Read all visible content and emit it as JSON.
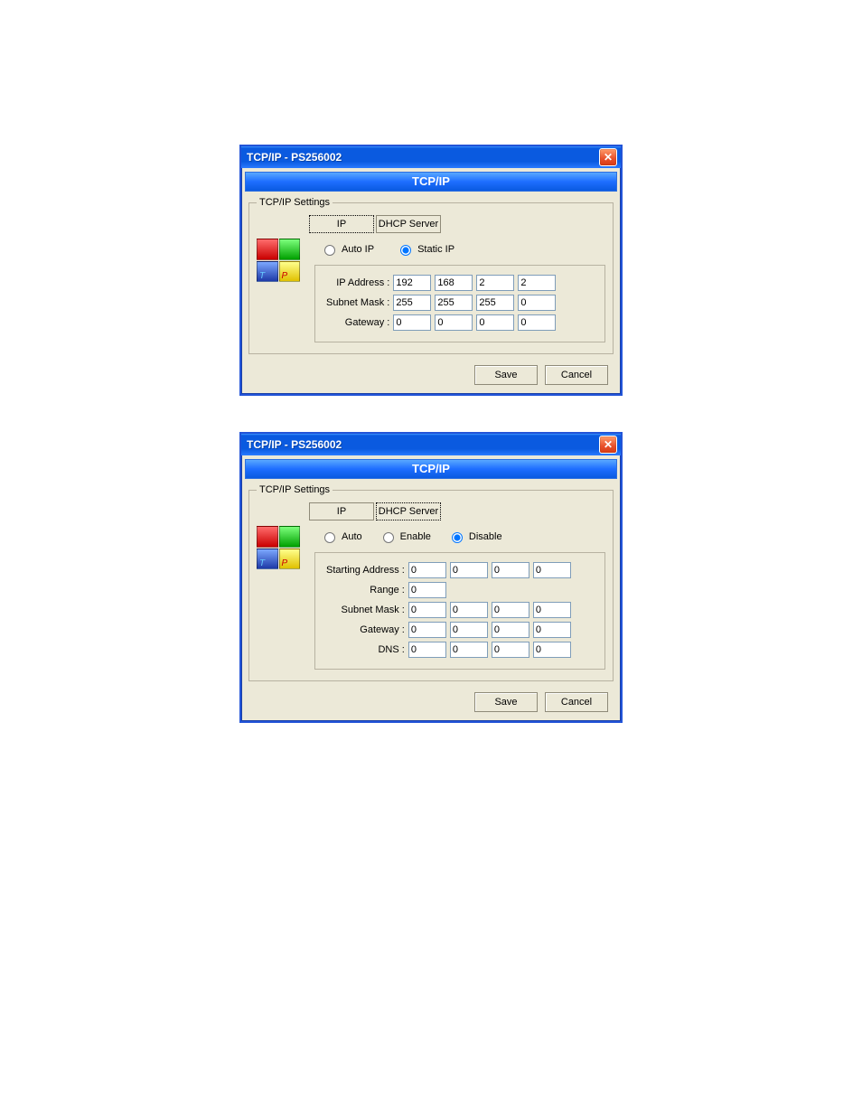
{
  "dialog1": {
    "title": "TCP/IP - PS256002",
    "banner": "TCP/IP",
    "group_legend": "TCP/IP Settings",
    "tabs": {
      "ip": "IP",
      "dhcp": "DHCP Server"
    },
    "radios": {
      "auto_ip": "Auto IP",
      "static_ip": "Static IP"
    },
    "labels": {
      "ip_address": "IP Address :",
      "subnet": "Subnet Mask :",
      "gateway": "Gateway :"
    },
    "values": {
      "ip": [
        "192",
        "168",
        "2",
        "2"
      ],
      "subnet": [
        "255",
        "255",
        "255",
        "0"
      ],
      "gateway": [
        "0",
        "0",
        "0",
        "0"
      ]
    },
    "buttons": {
      "save": "Save",
      "cancel": "Cancel"
    }
  },
  "dialog2": {
    "title": "TCP/IP - PS256002",
    "banner": "TCP/IP",
    "group_legend": "TCP/IP Settings",
    "tabs": {
      "ip": "IP",
      "dhcp": "DHCP Server"
    },
    "radios": {
      "auto": "Auto",
      "enable": "Enable",
      "disable": "Disable"
    },
    "labels": {
      "starting": "Starting Address :",
      "range": "Range :",
      "subnet": "Subnet Mask :",
      "gateway": "Gateway :",
      "dns": "DNS :"
    },
    "values": {
      "starting": [
        "0",
        "0",
        "0",
        "0"
      ],
      "range": [
        "0"
      ],
      "subnet": [
        "0",
        "0",
        "0",
        "0"
      ],
      "gateway": [
        "0",
        "0",
        "0",
        "0"
      ],
      "dns": [
        "0",
        "0",
        "0",
        "0"
      ]
    },
    "buttons": {
      "save": "Save",
      "cancel": "Cancel"
    }
  },
  "logo_letters": {
    "b": "T",
    "y": "P"
  }
}
